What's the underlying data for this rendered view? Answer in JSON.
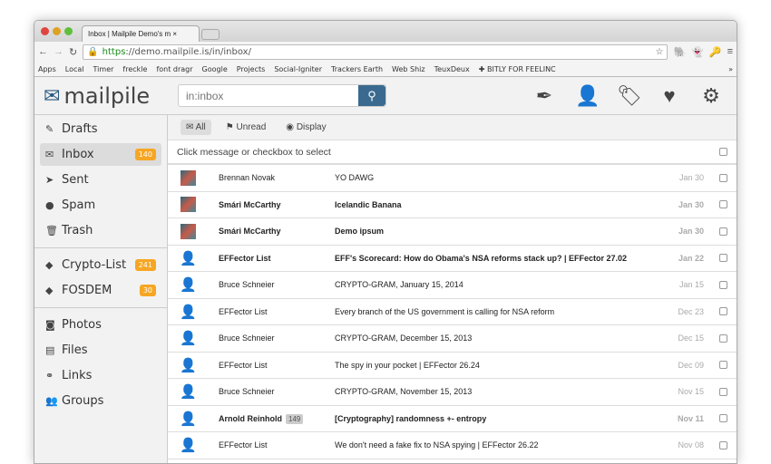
{
  "browser": {
    "tab_title": "Inbox | Mailpile Demo's m",
    "url_scheme": "https",
    "url_rest": "://demo.mailpile.is/in/inbox/",
    "bookmarks": [
      "Apps",
      "Local",
      "Timer",
      "freckle",
      "font dragr",
      "Google",
      "Projects",
      "Social-Igniter",
      "Trackers Earth",
      "Web Shiz",
      "TeuxDeux",
      "✚ BITLY FOR FEELINC"
    ],
    "more": "»"
  },
  "app": {
    "logo": "mailpile",
    "search_placeholder": "in:inbox"
  },
  "sidebar": {
    "items": [
      {
        "label": "Drafts",
        "icon": "pencil-icon",
        "glyph": "✎"
      },
      {
        "label": "Inbox",
        "icon": "envelope-icon",
        "glyph": "✉",
        "badge": "140"
      },
      {
        "label": "Sent",
        "icon": "paper-plane-icon",
        "glyph": "➤"
      },
      {
        "label": "Spam",
        "icon": "piggy-icon",
        "glyph": "●"
      },
      {
        "label": "Trash",
        "icon": "trash-icon",
        "glyph": "🗑"
      }
    ],
    "tags": [
      {
        "label": "Crypto-List",
        "badge": "241"
      },
      {
        "label": "FOSDEM",
        "badge": "30"
      }
    ],
    "apps": [
      {
        "label": "Photos",
        "glyph": "◙"
      },
      {
        "label": "Files",
        "glyph": "▤"
      },
      {
        "label": "Links",
        "glyph": "⚭"
      },
      {
        "label": "Groups",
        "glyph": "👥"
      }
    ]
  },
  "filters": {
    "all": "All",
    "unread": "Unread",
    "display": "Display"
  },
  "select_hint": "Click message or checkbox to select",
  "messages": [
    {
      "from": "Brennan Novak",
      "subject": "YO DAWG",
      "date": "Jan 30",
      "unread": false,
      "photo": true
    },
    {
      "from": "Smári McCarthy",
      "subject": "Icelandic Banana",
      "date": "Jan 30",
      "unread": true,
      "photo": true
    },
    {
      "from": "Smári McCarthy",
      "subject": "Demo ipsum",
      "date": "Jan 30",
      "unread": true,
      "photo": true
    },
    {
      "from": "EFFector List",
      "subject": "EFF's Scorecard: How do Obama's NSA reforms stack up? | EFFector 27.02",
      "date": "Jan 22",
      "unread": true
    },
    {
      "from": "Bruce Schneier",
      "subject": "CRYPTO-GRAM, January 15, 2014",
      "date": "Jan 15",
      "unread": false
    },
    {
      "from": "EFFector List",
      "subject": "Every branch of the US government is calling for NSA reform",
      "date": "Dec 23",
      "unread": false
    },
    {
      "from": "Bruce Schneier",
      "subject": "CRYPTO-GRAM, December 15, 2013",
      "date": "Dec 15",
      "unread": false
    },
    {
      "from": "EFFector List",
      "subject": "The spy in your pocket | EFFector 26.24",
      "date": "Dec 09",
      "unread": false
    },
    {
      "from": "Bruce Schneier",
      "subject": "CRYPTO-GRAM, November 15, 2013",
      "date": "Nov 15",
      "unread": false
    },
    {
      "from": "Arnold Reinhold",
      "count": "149",
      "subject": "[Cryptography] randomness +- entropy",
      "date": "Nov 11",
      "unread": true
    },
    {
      "from": "EFFector List",
      "subject": "We don't need a fake fix to NSA spying | EFFector 26.22",
      "date": "Nov 08",
      "unread": false
    }
  ]
}
